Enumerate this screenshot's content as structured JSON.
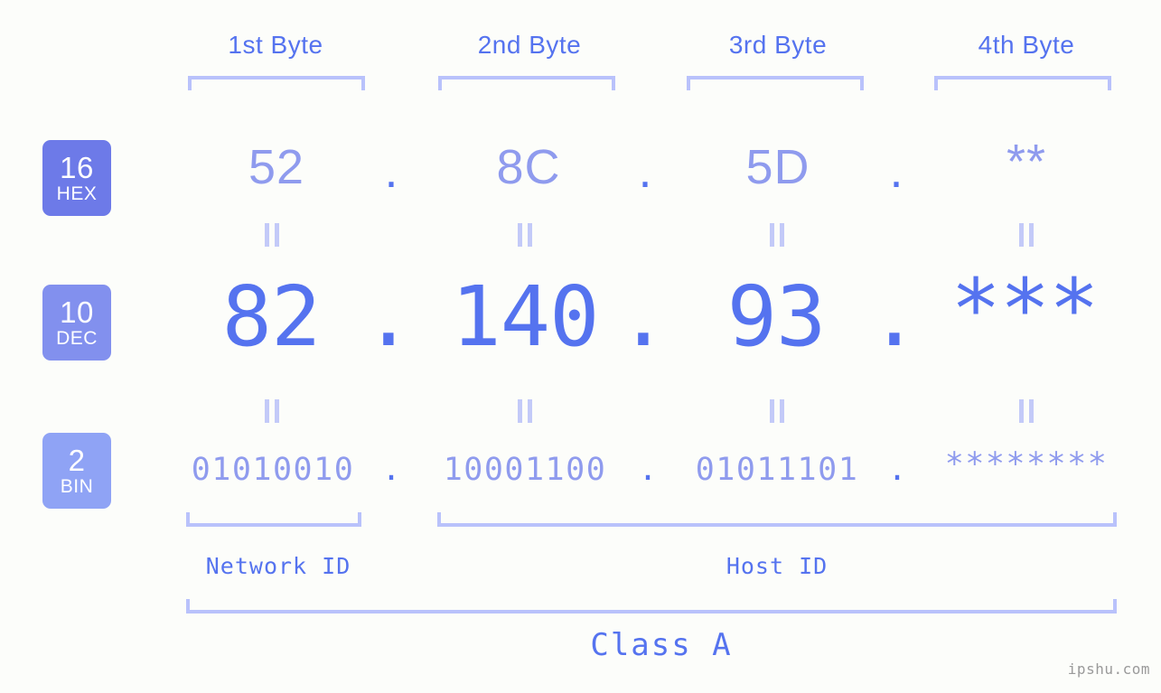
{
  "meta": {
    "watermark": "ipshu.com",
    "background_color": "#fcfdfa",
    "accent_color": "#5573ef",
    "muted_accent_color": "#8f9bee",
    "bracket_color": "#b9c2fb"
  },
  "headers": {
    "byte1": "1st Byte",
    "byte2": "2nd Byte",
    "byte3": "3rd Byte",
    "byte4": "4th Byte"
  },
  "bases": [
    {
      "number": "16",
      "abbr": "HEX",
      "color": "#6d7ae8"
    },
    {
      "number": "10",
      "abbr": "DEC",
      "color": "#8290ee"
    },
    {
      "number": "2",
      "abbr": "BIN",
      "color": "#8fa3f5"
    }
  ],
  "rows": {
    "hex": {
      "label": "HEX",
      "values": [
        "52",
        "8C",
        "5D",
        "**"
      ],
      "separator": "."
    },
    "dec": {
      "label": "DEC",
      "values": [
        "82",
        "140",
        "93",
        "***"
      ],
      "separator": "."
    },
    "bin": {
      "label": "BIN",
      "values": [
        "01010010",
        "10001100",
        "01011101",
        "********"
      ],
      "separator": "."
    }
  },
  "equals_symbol": "=",
  "segments": {
    "network_id": "Network ID",
    "host_id": "Host ID",
    "class": "Class A"
  }
}
